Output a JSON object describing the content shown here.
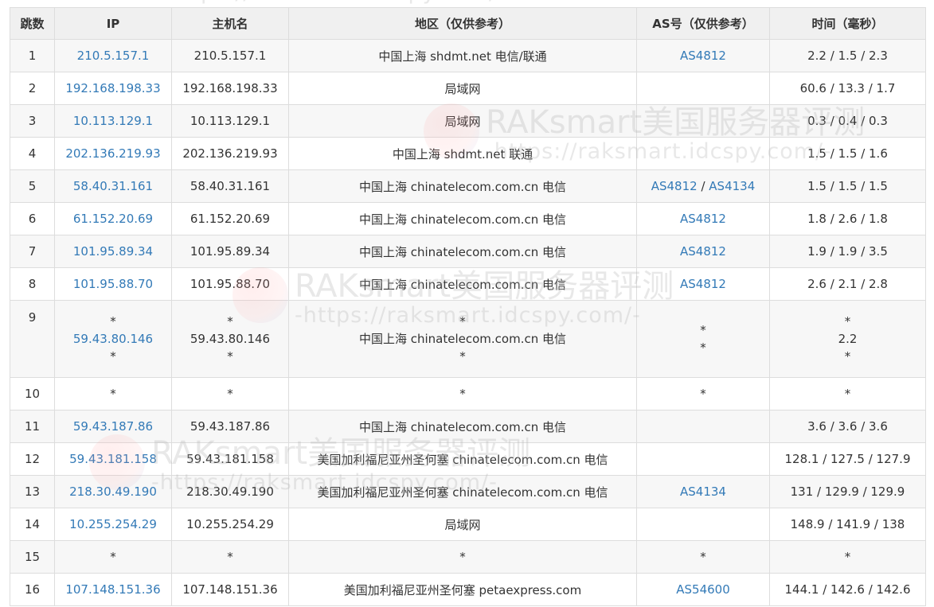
{
  "watermark": {
    "brand": "RAKsmart美国服务器评测",
    "url": "-https://raksmart.idcspy.com/-"
  },
  "table": {
    "headers": {
      "hop": "跳数",
      "ip": "IP",
      "host": "主机名",
      "region": "地区（仅供参考）",
      "as": "AS号（仅供参考）",
      "time": "时间（毫秒）"
    },
    "rows": [
      {
        "hop": "1",
        "ip": "210.5.157.1",
        "host": "210.5.157.1",
        "region": "中国上海 shdmt.net 电信/联通",
        "as1": "AS4812",
        "as_sep": "",
        "as2": "",
        "time": "2.2 / 1.5 / 2.3"
      },
      {
        "hop": "2",
        "ip": "192.168.198.33",
        "host": "192.168.198.33",
        "region": "局域网",
        "as1": "",
        "as_sep": "",
        "as2": "",
        "time": "60.6 / 13.3 / 1.7"
      },
      {
        "hop": "3",
        "ip": "10.113.129.1",
        "host": "10.113.129.1",
        "region": "局域网",
        "as1": "",
        "as_sep": "",
        "as2": "",
        "time": "0.3 / 0.4 / 0.3"
      },
      {
        "hop": "4",
        "ip": "202.136.219.93",
        "host": "202.136.219.93",
        "region": "中国上海 shdmt.net 联通",
        "as1": "",
        "as_sep": "",
        "as2": "",
        "time": "1.5 / 1.5 / 1.6"
      },
      {
        "hop": "5",
        "ip": "58.40.31.161",
        "host": "58.40.31.161",
        "region": "中国上海 chinatelecom.com.cn 电信",
        "as1": "AS4812",
        "as_sep": " / ",
        "as2": "AS4134",
        "time": "1.5 / 1.5 / 1.5"
      },
      {
        "hop": "6",
        "ip": "61.152.20.69",
        "host": "61.152.20.69",
        "region": "中国上海 chinatelecom.com.cn 电信",
        "as1": "AS4812",
        "as_sep": "",
        "as2": "",
        "time": "1.8 / 2.6 / 1.8"
      },
      {
        "hop": "7",
        "ip": "101.95.89.34",
        "host": "101.95.89.34",
        "region": "中国上海 chinatelecom.com.cn 电信",
        "as1": "AS4812",
        "as_sep": "",
        "as2": "",
        "time": "1.9 / 1.9 / 3.5"
      },
      {
        "hop": "8",
        "ip": "101.95.88.70",
        "host": "101.95.88.70",
        "region": "中国上海 chinatelecom.com.cn 电信",
        "as1": "AS4812",
        "as_sep": "",
        "as2": "",
        "time": "2.6 / 2.1 / 2.8"
      }
    ],
    "row9": {
      "hop": "9",
      "ip": [
        "*",
        "59.43.80.146",
        "*"
      ],
      "host": [
        "*",
        "59.43.80.146",
        "*"
      ],
      "region": [
        "*",
        "中国上海 chinatelecom.com.cn 电信",
        "*"
      ],
      "as": [
        "*",
        "",
        "*"
      ],
      "time": [
        "*",
        "2.2",
        "*"
      ]
    },
    "rows_b": [
      {
        "hop": "10",
        "ip": "*",
        "host": "*",
        "region": "*",
        "as1": "*",
        "as_sep": "",
        "as2": "",
        "time": "*"
      },
      {
        "hop": "11",
        "ip": "59.43.187.86",
        "host": "59.43.187.86",
        "region": "中国上海 chinatelecom.com.cn 电信",
        "as1": "",
        "as_sep": "",
        "as2": "",
        "time": "3.6 / 3.6 / 3.6"
      },
      {
        "hop": "12",
        "ip": "59.43.181.158",
        "host": "59.43.181.158",
        "region": "美国加利福尼亚州圣何塞 chinatelecom.com.cn 电信",
        "as1": "",
        "as_sep": "",
        "as2": "",
        "time": "128.1 / 127.5 / 127.9"
      },
      {
        "hop": "13",
        "ip": "218.30.49.190",
        "host": "218.30.49.190",
        "region": "美国加利福尼亚州圣何塞 chinatelecom.com.cn 电信",
        "as1": "AS4134",
        "as_sep": "",
        "as2": "",
        "time": "131 / 129.9 / 129.9"
      },
      {
        "hop": "14",
        "ip": "10.255.254.29",
        "host": "10.255.254.29",
        "region": "局域网",
        "as1": "",
        "as_sep": "",
        "as2": "",
        "time": "148.9 / 141.9 / 138"
      },
      {
        "hop": "15",
        "ip": "*",
        "host": "*",
        "region": "*",
        "as1": "*",
        "as_sep": "",
        "as2": "",
        "time": "*"
      },
      {
        "hop": "16",
        "ip": "107.148.151.36",
        "host": "107.148.151.36",
        "region": "美国加利福尼亚州圣何塞 petaexpress.com",
        "as1": "AS54600",
        "as_sep": "",
        "as2": "",
        "time": "144.1 / 142.6 / 142.6"
      }
    ]
  },
  "colors": {
    "link": "#337ab7",
    "text": "#333333",
    "header_bg": "#f0f0f0",
    "stripe_bg": "#f7f7f7",
    "border": "#dddddd"
  }
}
